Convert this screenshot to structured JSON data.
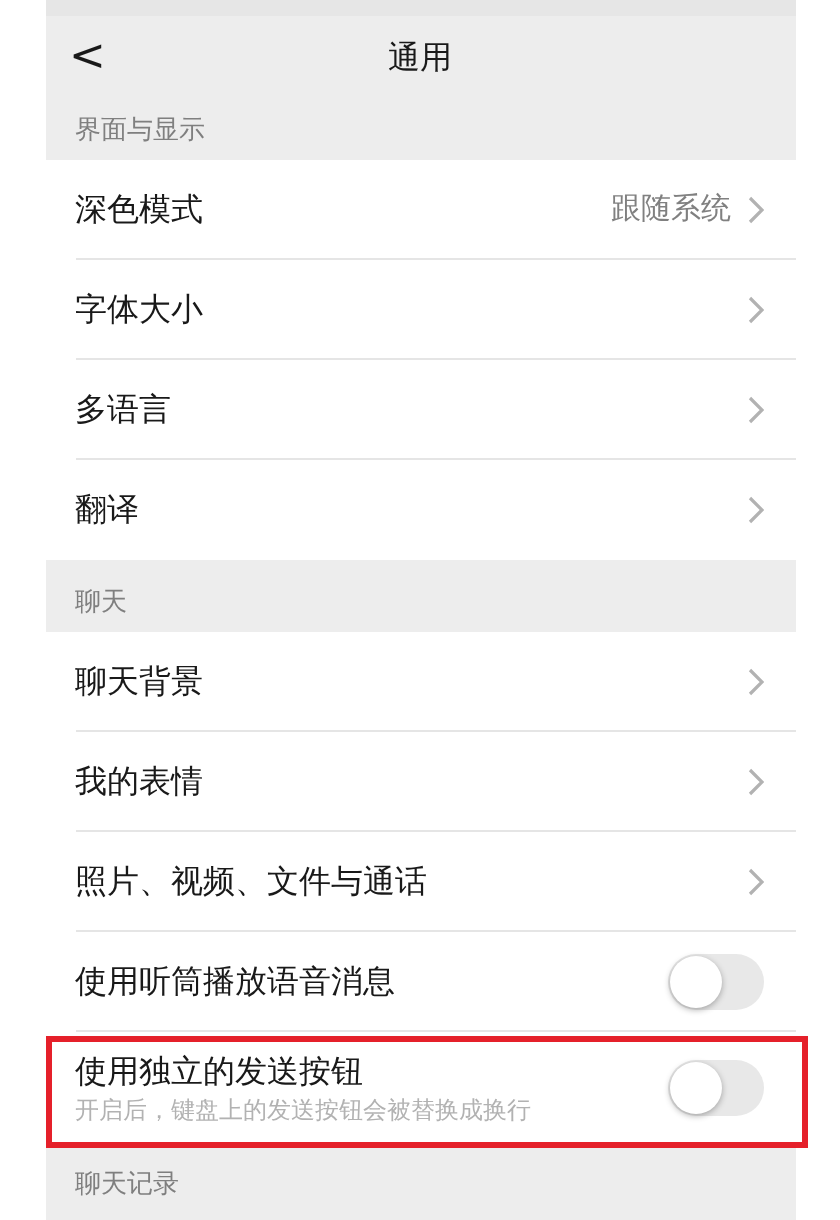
{
  "nav": {
    "back": "<",
    "title": "通用"
  },
  "sections": [
    {
      "title": "界面与显示",
      "rows": [
        {
          "kind": "link",
          "label": "深色模式",
          "value": "跟随系统",
          "highlighted": false
        },
        {
          "kind": "link",
          "label": "字体大小",
          "highlighted": false
        },
        {
          "kind": "link",
          "label": "多语言",
          "highlighted": false
        },
        {
          "kind": "link",
          "label": "翻译",
          "highlighted": false
        }
      ]
    },
    {
      "title": "聊天",
      "rows": [
        {
          "kind": "link",
          "label": "聊天背景",
          "highlighted": false
        },
        {
          "kind": "link",
          "label": "我的表情",
          "highlighted": false
        },
        {
          "kind": "link",
          "label": "照片、视频、文件与通话",
          "highlighted": false
        },
        {
          "kind": "toggle",
          "label": "使用听筒播放语音消息",
          "on": false,
          "highlighted": false
        },
        {
          "kind": "toggle",
          "label": "使用独立的发送按钮",
          "description": "开启后，键盘上的发送按钮会被替换成换行",
          "on": false,
          "highlighted": true
        }
      ]
    },
    {
      "title": "聊天记录"
    }
  ]
}
